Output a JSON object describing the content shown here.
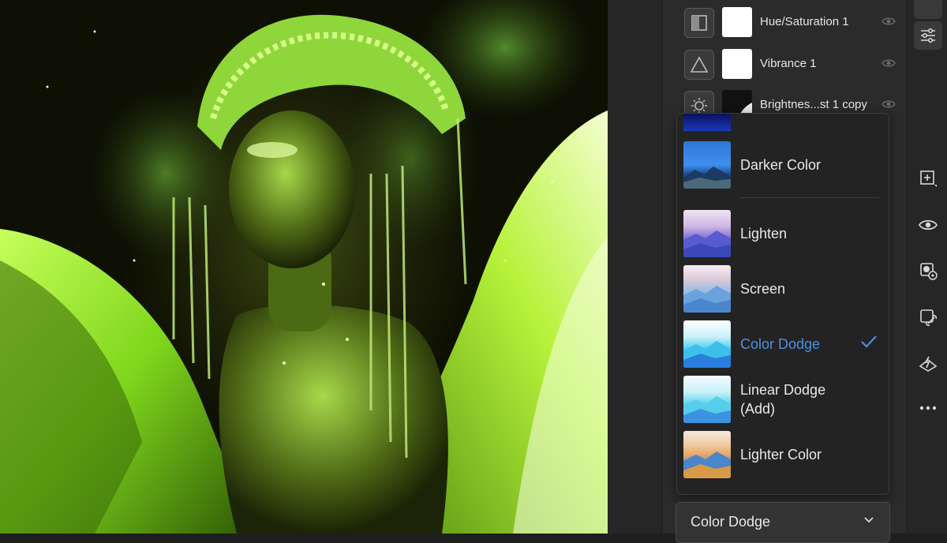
{
  "layers": [
    {
      "name": "Hue/Saturation 1",
      "type_icon": "hue-saturation-icon",
      "visibility_icon": "eye-icon"
    },
    {
      "name": "Vibrance 1",
      "type_icon": "vibrance-triangle-icon",
      "visibility_icon": "eye-icon"
    },
    {
      "name": "Brightnes...st 1 copy",
      "type_icon": "brightness-sun-icon",
      "visibility_icon": "eye-icon"
    }
  ],
  "blend_menu": {
    "options": [
      {
        "label": "Darker Color",
        "selected": false
      },
      {
        "label": "Lighten",
        "selected": false
      },
      {
        "label": "Screen",
        "selected": false
      },
      {
        "label": "Color Dodge",
        "selected": true
      },
      {
        "label": "Linear Dodge (Add)",
        "selected": false
      },
      {
        "label": "Lighter Color",
        "selected": false
      }
    ],
    "current_value": "Color Dodge",
    "selected_color": "#4d8fe0"
  },
  "toolbar": {
    "icons": [
      "layer-properties-icon",
      "add-layer-icon",
      "visibility-eye-icon",
      "layer-mask-icon",
      "link-layers-icon",
      "adjustment-layer-icon",
      "more-options-icon"
    ]
  },
  "canvas": {
    "description_color": "#7bd42a"
  }
}
